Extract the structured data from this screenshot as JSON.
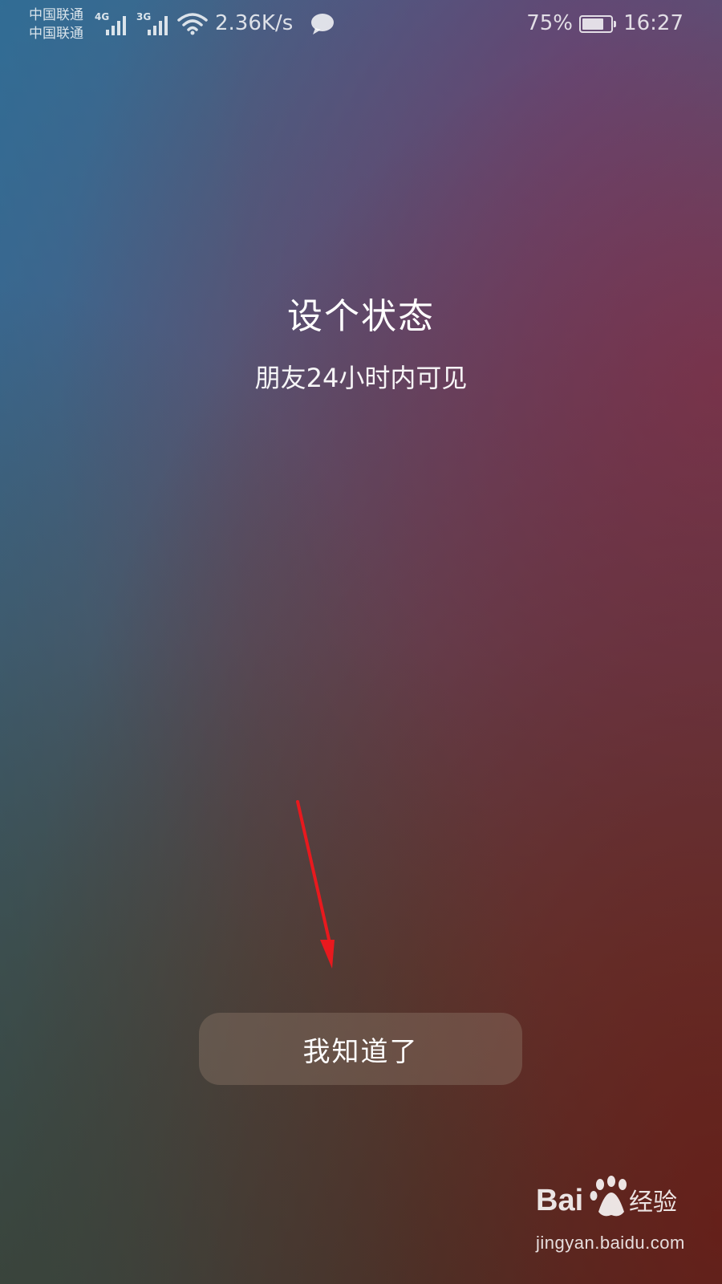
{
  "status_bar": {
    "carrier_1": "中国联通",
    "carrier_2": "中国联通",
    "signal_1_type": "4G",
    "signal_2_type": "3G",
    "wifi_icon": "wifi-icon",
    "network_speed": "2.36K/s",
    "notification_icon": "chat-bubble-icon",
    "battery_percent": "75%",
    "battery_level": 0.75,
    "time": "16:27"
  },
  "content": {
    "title": "设个状态",
    "subtitle": "朋友24小时内可见",
    "confirm_button_label": "我知道了",
    "annotation_color": "#e8191e"
  },
  "watermark": {
    "logo_text": "Bai 经验",
    "url": "jingyan.baidu.com"
  }
}
